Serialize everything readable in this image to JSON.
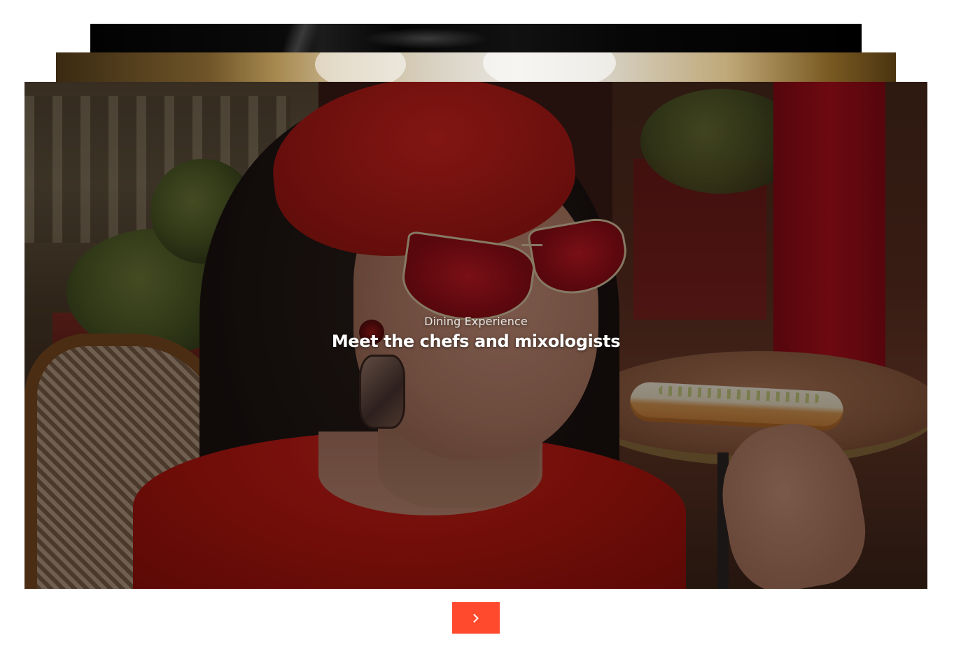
{
  "slider": {
    "active_slide": {
      "eyebrow": "Dining Experience",
      "headline": "Meet the chefs and mixologists"
    },
    "next_icon": "chevron-right-icon",
    "accent_color": "#ff4a2d"
  }
}
